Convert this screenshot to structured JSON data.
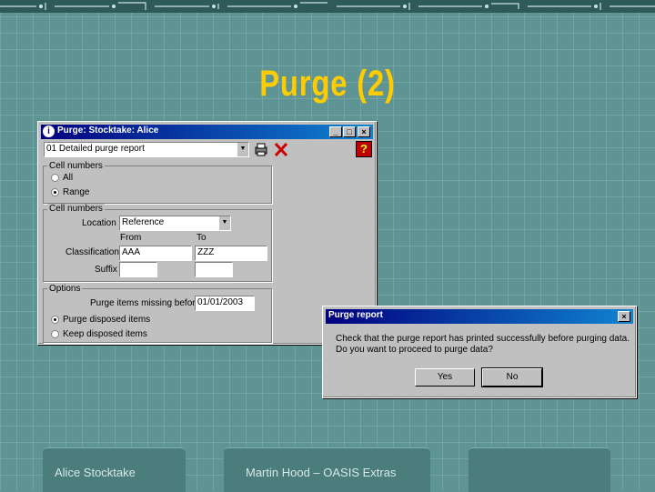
{
  "slide": {
    "title": "Purge (2)",
    "footer": {
      "left": "Alice Stocktake",
      "center": "Martin Hood – OASIS Extras",
      "right": ""
    }
  },
  "main_window": {
    "title": "Purge: Stocktake: Alice",
    "icon": "info-icon",
    "controls": [
      "minimize-icon",
      "maximize-icon",
      "close-icon"
    ],
    "report_select": "01 Detailed purge report",
    "toolbar_icons": [
      "printer-icon",
      "cancel-x-icon",
      "help-icon"
    ],
    "cell_numbers_1": {
      "label": "Cell numbers",
      "options": [
        "All",
        "Range"
      ],
      "selected": "Range"
    },
    "cell_numbers_2": {
      "label": "Cell numbers",
      "location_label": "Location",
      "location_value": "Reference",
      "from_label": "From",
      "to_label": "To",
      "classification_label": "Classification",
      "classification_from": "AAA",
      "classification_to": "ZZZ",
      "suffix_label": "Suffix",
      "suffix_from": "",
      "suffix_to": ""
    },
    "options": {
      "label": "Options",
      "missing_label": "Purge items missing before",
      "missing_date": "01/01/2003",
      "radio_1": "Purge disposed items",
      "radio_2": "Keep disposed items",
      "selected": "Purge disposed items"
    }
  },
  "dialog": {
    "title": "Purge report",
    "message_1": "Check that the purge report has printed successfully before purging data.",
    "message_2": "Do you want to proceed to purge data?",
    "yes_label": "Yes",
    "no_label": "No"
  },
  "colors": {
    "background": "#5e9494",
    "title_yellow": "#ffcc00",
    "titlebar": "#000080",
    "footer_tab": "#4a7d7b"
  }
}
